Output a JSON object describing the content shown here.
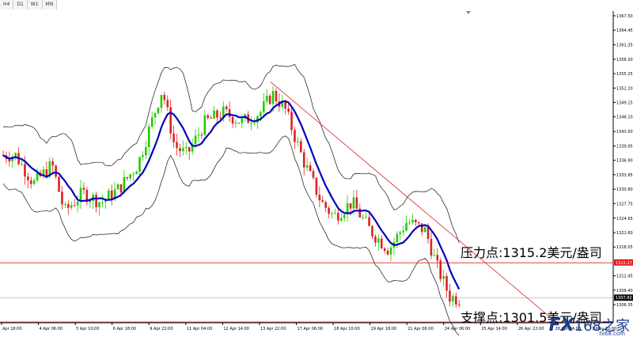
{
  "timeframes": [
    "H4",
    "D1",
    "W1",
    "MN"
  ],
  "annotations": {
    "resistance": "压力点:1315.2美元/盎司",
    "support": "支撑点:1301.5美元/盎司"
  },
  "watermark": {
    "brand": "FX",
    "cn": "168之家",
    "url": "fx68.com"
  },
  "colors": {
    "bull": "#22cc00",
    "bear": "#dd2222",
    "ma": "#0000bb",
    "band": "#111111",
    "trend": "#dd2222",
    "hline": "#dd2222"
  },
  "chart_data": {
    "type": "candlestick",
    "symbol": "XAUUSD",
    "ylim": [
      1302.5,
      1368.5
    ],
    "yticks": [
      1367.5,
      1364.45,
      1361.35,
      1358.3,
      1355.25,
      1352.2,
      1349.15,
      1346.1,
      1343.0,
      1339.95,
      1336.9,
      1333.85,
      1330.8,
      1327.75,
      1324.65,
      1321.6,
      1318.55,
      1312.45,
      1309.4,
      1306.35
    ],
    "price_tags": {
      "resistance": 1315.27,
      "current": 1307.82
    },
    "xticks": [
      "Apr 18:00",
      "4 Apr 06:00",
      "5 Apr 10:00",
      "6 Apr 18:00",
      "9 Apr 22:00",
      "11 Apr 04:00",
      "12 Apr 14:00",
      "13 Apr 22:00",
      "17 Apr 06:00",
      "18 Apr 10:00",
      "19 Apr 18:00",
      "21 Apr 06:00",
      "24 Apr 06:00",
      "25 Apr 14:00",
      "26 Apr 22:00",
      "28 Apr 04:00",
      "1 May 10:00"
    ],
    "indicators": [
      "Bollinger Bands",
      "Moving Average"
    ],
    "lines": {
      "resistance_level": 1315.2,
      "support_level": 1301.5,
      "current_price": 1307.82,
      "trendline": {
        "from": 1353.5,
        "to": 1303.0
      }
    },
    "grid": false
  }
}
